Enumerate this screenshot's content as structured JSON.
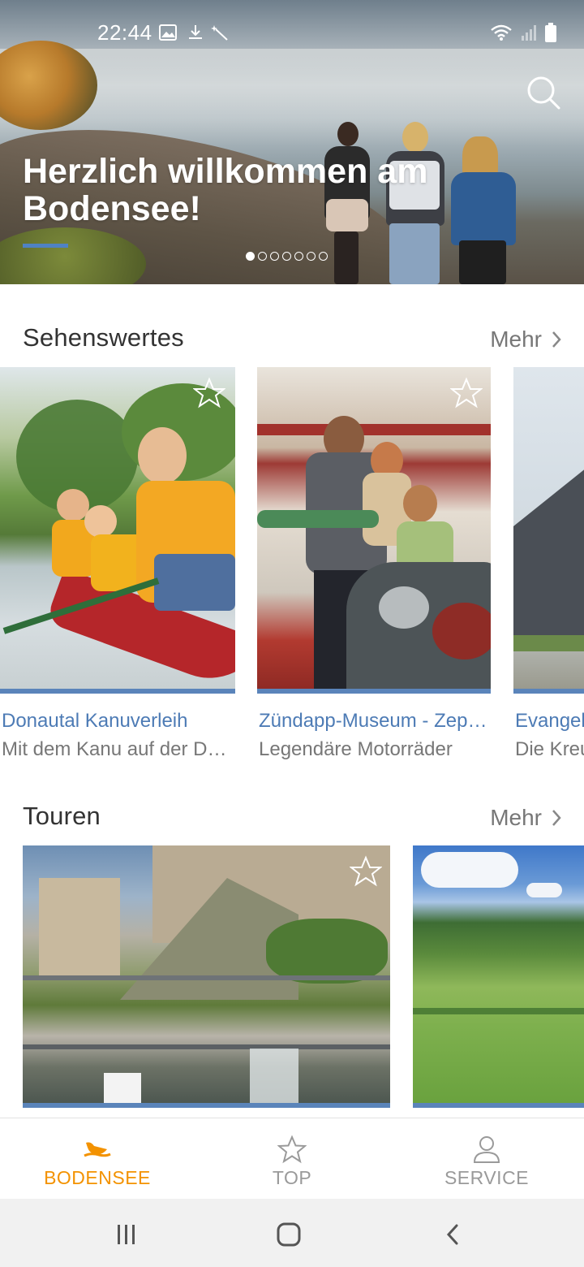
{
  "status_bar": {
    "time": "22:44",
    "icons_left": [
      "gallery-icon",
      "download-icon",
      "magic-wand-icon"
    ],
    "icons_right": [
      "wifi-icon",
      "signal-icon",
      "battery-icon"
    ]
  },
  "hero": {
    "title": "Herzlich willkommen am Bodensee!",
    "slide_count": 7,
    "active_slide": 1,
    "accent_color": "#4f82c4"
  },
  "sections": [
    {
      "title": "Sehenswertes",
      "more_label": "Mehr",
      "cards": [
        {
          "title": "Donautal Kanuverleih",
          "subtitle": "Mit dem Kanu auf der Donau"
        },
        {
          "title": "Zündapp-Museum - Zeppelin",
          "subtitle": "Legendäre Motorräder"
        },
        {
          "title": "Evangelische Kirche",
          "subtitle": "Die Kreuzkirche"
        }
      ]
    },
    {
      "title": "Touren",
      "more_label": "Mehr",
      "cards": []
    }
  ],
  "bottom_nav": {
    "items": [
      {
        "label": "BODENSEE",
        "icon": "bodensee-swan-icon",
        "active": true
      },
      {
        "label": "TOP",
        "icon": "star-icon",
        "active": false
      },
      {
        "label": "SERVICE",
        "icon": "user-icon",
        "active": false
      }
    ],
    "active_color": "#f39200",
    "inactive_color": "#999999"
  },
  "system_nav": [
    "recent-apps-icon",
    "home-icon",
    "back-icon"
  ]
}
